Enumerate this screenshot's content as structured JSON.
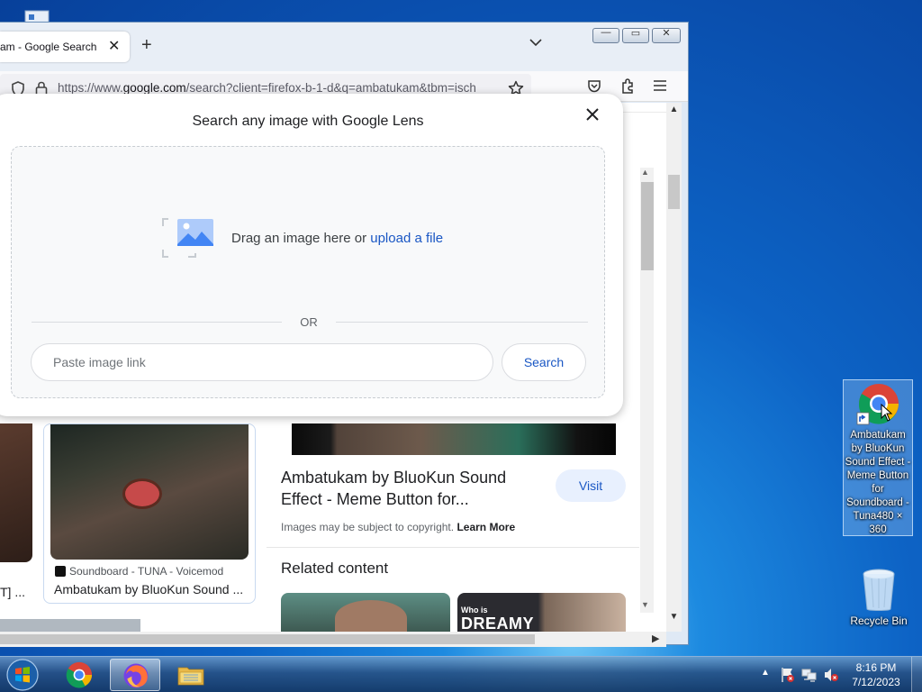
{
  "browser": {
    "tab": {
      "title": "am - Google Search",
      "close_glyph": "✕"
    },
    "new_tab_glyph": "+",
    "tab_list_glyph": "⌄",
    "url": {
      "prefix": "https://www.",
      "host": "google.com",
      "rest": "/search?client=firefox-b-1-d&q=ambatukam&tbm=isch"
    },
    "window_buttons": {
      "minimize": "—",
      "maximize": "▭",
      "close": "✕"
    }
  },
  "lens": {
    "heading": "Search any image with Google Lens",
    "close_glyph": "✕",
    "drag_text": "Drag an image here or ",
    "upload_link": "upload a file",
    "or_text": "OR",
    "link_placeholder": "Paste image link",
    "search_label": "Search"
  },
  "results": {
    "left_card": {
      "source": "Soundboard - TUNA - Voicemod",
      "title": "Ambatukam by BluoKun Sound ..."
    },
    "far_left_text": "T] ...",
    "preview": {
      "title": "Ambatukam by BluoKun Sound Effect - Meme Button for...",
      "visit_label": "Visit",
      "copyright_text": "Images may be subject to copyright. ",
      "learn_more": "Learn More"
    },
    "related_heading": "Related content",
    "related_2_caption": "Who is",
    "related_2_big": "DREAMY"
  },
  "desktop": {
    "chrome_shortcut_label": "Ambatukam by BluoKun Sound Effect - Meme Button for Soundboard - Tuna480 × 360",
    "recycle_bin_label": "Recycle Bin"
  },
  "taskbar": {
    "time": "8:16 PM",
    "date": "7/12/2023",
    "tray_arrow": "▲"
  },
  "colors": {
    "google_blue": "#1a57c4",
    "lens_bg": "#f8f9fa",
    "visit_bg": "#e8f0fe"
  },
  "icons": [
    "shield-icon",
    "lock-icon",
    "star-icon",
    "pocket-icon",
    "extensions-icon",
    "menu-icon",
    "image-upload-icon",
    "chrome-icon",
    "firefox-icon",
    "folder-icon",
    "recycle-bin-icon",
    "windows-start-icon"
  ]
}
